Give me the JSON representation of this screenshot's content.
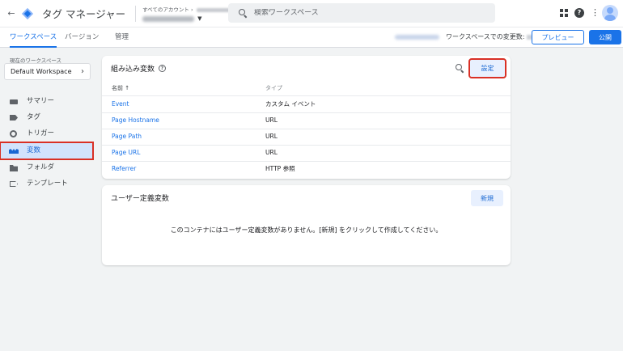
{
  "header": {
    "back_icon": "arrow-back-icon",
    "app_name": "タグ マネージャー",
    "account_label": "すべてのアカウント",
    "account_sep": "›",
    "search_placeholder": "検索ワークスペース",
    "help_glyph": "?",
    "more_glyph": "⋮"
  },
  "tabs": {
    "workspace": "ワークスペース",
    "versions": "バージョン",
    "admin": "管理"
  },
  "workspace_bar": {
    "changes_label": "ワークスペースでの変更数:",
    "preview_label": "プレビュー",
    "publish_label": "公開"
  },
  "sidebar": {
    "current_ws_label": "現在のワークスペース",
    "workspace_name": "Default Workspace",
    "items": [
      {
        "label": "サマリー",
        "icon": "summary-icon"
      },
      {
        "label": "タグ",
        "icon": "tag-icon"
      },
      {
        "label": "トリガー",
        "icon": "trigger-icon"
      },
      {
        "label": "変数",
        "icon": "variables-icon"
      },
      {
        "label": "フォルダ",
        "icon": "folder-icon"
      },
      {
        "label": "テンプレート",
        "icon": "template-icon"
      }
    ]
  },
  "builtin": {
    "title": "組み込み変数",
    "configure_label": "設定",
    "col_name": "名前 ↑",
    "col_type": "タイプ",
    "rows": [
      {
        "name": "Event",
        "type": "カスタム イベント"
      },
      {
        "name": "Page Hostname",
        "type": "URL"
      },
      {
        "name": "Page Path",
        "type": "URL"
      },
      {
        "name": "Page URL",
        "type": "URL"
      },
      {
        "name": "Referrer",
        "type": "HTTP 参照"
      }
    ]
  },
  "user_defined": {
    "title": "ユーザー定義変数",
    "new_label": "新規",
    "empty_message": "このコンテナにはユーザー定義変数がありません。[新規] をクリックして作成してください。"
  },
  "colors": {
    "accent": "#1a73e8",
    "highlight_box": "#d93025",
    "active_nav_bg": "#d2e3fc"
  }
}
